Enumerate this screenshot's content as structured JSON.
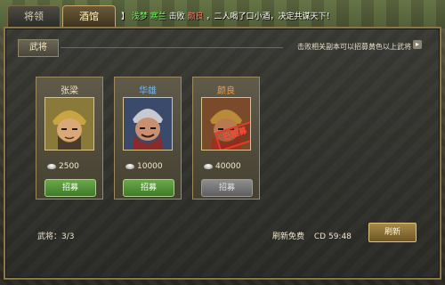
{
  "tabs": [
    {
      "label": "将领",
      "active": false
    },
    {
      "label": "酒馆",
      "active": true
    }
  ],
  "ticker": {
    "prefix": "】",
    "player1": "浅梦",
    "player2": "寒兰",
    "mid": "击败",
    "target": "颜良",
    "suffix": "，二人喝了口小酒，决定共谋天下！"
  },
  "panel": {
    "section_label": "武将",
    "hint": "击败相关副本可以招募黄色以上武将"
  },
  "generals": [
    {
      "name": "张梁",
      "name_color": "#efe2c2",
      "cost": "2500",
      "button": "招募",
      "button_enabled": true,
      "stamp": ""
    },
    {
      "name": "华雄",
      "name_color": "#6ab8ff",
      "cost": "10000",
      "button": "招募",
      "button_enabled": true,
      "stamp": ""
    },
    {
      "name": "颜良",
      "name_color": "#ff9a3a",
      "cost": "40000",
      "button": "招募",
      "button_enabled": false,
      "stamp": "已招募"
    }
  ],
  "footer": {
    "count_label": "武将：3/3",
    "refresh_label": "刷新免费",
    "cd_label": "CD 59:48",
    "refresh_button": "刷新"
  }
}
